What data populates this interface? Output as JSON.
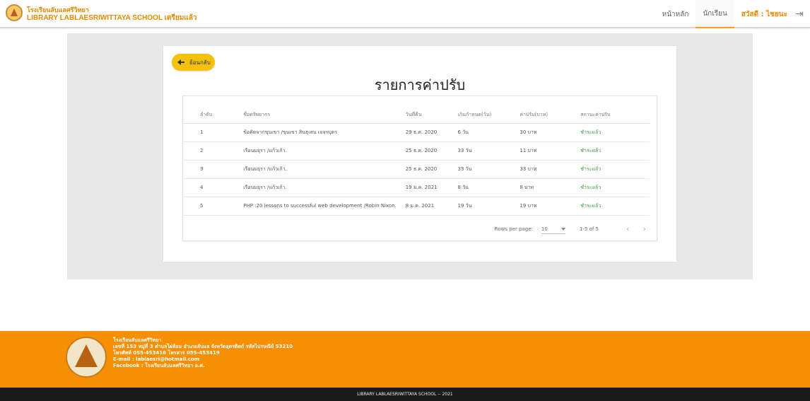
{
  "header": {
    "school_name": "โรงเรียนลับแลศรีวิทยา",
    "library_name": "LIBRARY LABLAESRIWITTAYA SCHOOL เตรียมแล้ว",
    "nav": [
      "หน้าหลัก",
      "นักเรียน"
    ],
    "user": "สวัสดี : ไชยนะ",
    "logout_icon": "logout-icon"
  },
  "page": {
    "back_label": "ย้อนกลับ",
    "title": "รายการค่าปรับ"
  },
  "table": {
    "headers": [
      "ลำดับ",
      "ชื่อทรัพยากร",
      "วันที่คืน",
      "เกินกำหนด(วัน)",
      "ค่าปรับ(บาท)",
      "สถานะค่าปรับ"
    ],
    "rows": [
      [
        "1",
        "ข้อคิดจากขุนเขา /ขุนเขา สินธุเสน เจจรบุตร",
        "29 ธ.ค. 2020",
        "6 วัน",
        "30 บาท",
        "ชำระแล้ว"
      ],
      [
        "2",
        "เรือนมยุรา /แก้วเก้า.",
        "25 ธ.ค. 2020",
        "33 วัน",
        "11 บาท",
        "ชำระแล้ว"
      ],
      [
        "3",
        "เรือนมยุรา /แก้วเก้า.",
        "25 ธ.ค. 2020",
        "33 วัน",
        "33 บาท",
        "ชำระแล้ว"
      ],
      [
        "4",
        "เรือนมยุรา /แก้วเก้า.",
        "19 ม.ค. 2021",
        "8 วัน",
        "8 บาท",
        "ชำระแล้ว"
      ],
      [
        "5",
        "PHP :20 lessons to successful web development /Robin Nixon.",
        "8 ม.ค. 2021",
        "19 วัน",
        "19 บาท",
        "ชำระแล้ว"
      ]
    ],
    "footer": {
      "rows_label": "Rows per page:",
      "rows_value": "10",
      "range": "1-5 of 5",
      "prev_icon": "chevron-left-icon",
      "next_icon": "chevron-right-icon"
    }
  },
  "footer": {
    "lines": [
      "โรงเรียนลับแลศรีวิทยา",
      "เลขที่ 153 หมู่ที่ 3 ตำบลไผ่ล้อม อำเภอลับแล จังหวัดอุตรดิตถ์ รหัสไปรษณีย์ 53210",
      "โทรศัพท์ 055-453416 โทรสาร 055-453419",
      "E-mail : lablaesri@hotmail.com",
      "Facebook : โรงเรียนลับแลศรีวิทยา อ.ศ."
    ],
    "copyright": "LIBRARY LABLAESRIWITTAYA SCHOOL -- 2021"
  }
}
